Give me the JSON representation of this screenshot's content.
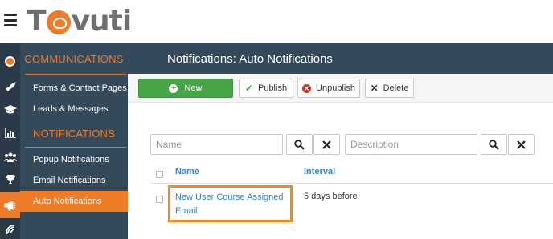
{
  "app": {
    "logo_text_left": "T",
    "logo_text_right": "vuti"
  },
  "icon_bar": [
    {
      "name": "logo-badge-icon"
    },
    {
      "name": "rocket-icon"
    },
    {
      "name": "graduation-cap-icon"
    },
    {
      "name": "bar-chart-icon"
    },
    {
      "name": "users-icon"
    },
    {
      "name": "trophy-icon"
    },
    {
      "name": "megaphone-icon"
    },
    {
      "name": "signal-icon"
    }
  ],
  "sidebar": {
    "section1": "COMMUNICATIONS",
    "items1": [
      "Forms & Contact Pages",
      "Leads & Messages"
    ],
    "section2": "NOTIFICATIONS",
    "items2": [
      "Popup Notifications",
      "Email Notifications",
      "Auto Notifications"
    ],
    "active_item": "Auto Notifications"
  },
  "header": {
    "title": "Notifications: Auto Notifications"
  },
  "toolbar": {
    "new_label": "New",
    "publish_label": "Publish",
    "unpublish_label": "Unpublish",
    "delete_label": "Delete"
  },
  "filters": {
    "name_placeholder": "Name",
    "description_placeholder": "Description"
  },
  "table": {
    "columns": [
      "Name",
      "Interval"
    ],
    "rows": [
      {
        "name_line1": "New User Course Assigned",
        "name_line2": "Email",
        "interval": "5 days before"
      }
    ]
  },
  "colors": {
    "accent": "#ee7b27",
    "sidebar": "#34495a",
    "new_button": "#46a546",
    "link": "#2f86c8"
  }
}
